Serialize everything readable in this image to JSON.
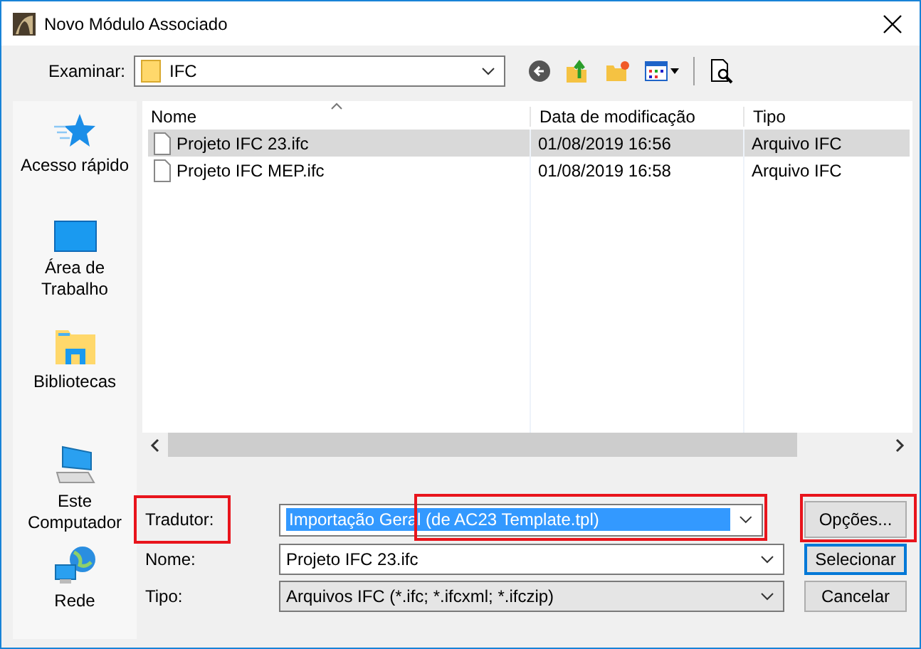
{
  "window": {
    "title": "Novo Módulo Associado"
  },
  "location": {
    "label": "Examinar:",
    "value": "IFC"
  },
  "places": [
    {
      "kind": "star",
      "label": "Acesso rápido"
    },
    {
      "kind": "desktop",
      "label": "Área de Trabalho"
    },
    {
      "kind": "library",
      "label": "Bibliotecas"
    },
    {
      "kind": "computer",
      "label": "Este Computador"
    },
    {
      "kind": "network",
      "label": "Rede"
    }
  ],
  "columns": [
    "Nome",
    "Data de modificação",
    "Tipo"
  ],
  "files": [
    {
      "name": "Projeto IFC 23.ifc",
      "modified": "01/08/2019 16:56",
      "type": "Arquivo IFC",
      "selected": true
    },
    {
      "name": "Projeto IFC MEP.ifc",
      "modified": "01/08/2019 16:58",
      "type": "Arquivo IFC",
      "selected": false
    }
  ],
  "translator": {
    "label": "Tradutor:",
    "value": "Importação Geral (de AC23 Template.tpl)"
  },
  "name_field": {
    "label": "Nome:",
    "value": "Projeto IFC 23.ifc"
  },
  "type_field": {
    "label": "Tipo:",
    "value": "Arquivos IFC (*.ifc; *.ifcxml; *.ifczip)"
  },
  "buttons": [
    {
      "label": "Opções...",
      "kind": "options"
    },
    {
      "label": "Selecionar",
      "kind": "default"
    },
    {
      "label": "Cancelar",
      "kind": "normal"
    }
  ]
}
